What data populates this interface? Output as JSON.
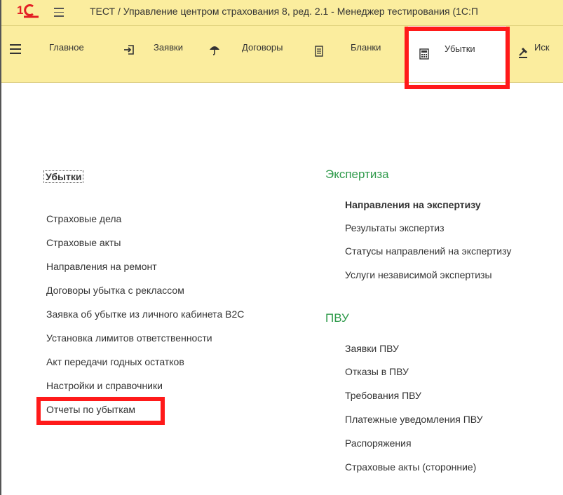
{
  "titlebar": {
    "title": "ТЕСТ / Управление центром страхования 8, ред. 2.1  - Менеджер тестирования (1С:П"
  },
  "sections": {
    "main": "Главное",
    "requests": "Заявки",
    "contracts": "Договоры",
    "forms": "Бланки",
    "losses": "Убытки",
    "more": "Иск"
  },
  "content": {
    "losses_heading": "Убытки",
    "losses_links": [
      "Страховые дела",
      "Страховые акты",
      "Направления на ремонт",
      "Договоры убытка с реклассом",
      "Заявка об убытке из личного кабинета B2C",
      "Установка лимитов ответственности",
      "Акт передачи годных остатков",
      "Настройки и справочники",
      "Отчеты по убыткам"
    ],
    "expertise_heading": "Экспертиза",
    "expertise_links": [
      "Направления на экспертизу",
      "Результаты экспертиз",
      "Статусы направлений на экспертизу",
      "Услуги независимой экспертизы"
    ],
    "pvu_heading": "ПВУ",
    "pvu_links": [
      "Заявки ПВУ",
      "Отказы в ПВУ",
      "Требования ПВУ",
      "Платежные уведомления ПВУ",
      "Распоряжения",
      "Страховые акты (сторонние)"
    ]
  },
  "colors": {
    "panel_bg": "#fbed9e",
    "group_heading": "#2e9a4a",
    "highlight": "#ff1a1a",
    "logo_red": "#e31e24"
  },
  "icons": {
    "logo": "1c-logo-icon",
    "requests": "login-arrow-icon",
    "contracts": "umbrella-icon",
    "forms": "document-icon",
    "losses": "calculator-icon",
    "more": "gavel-icon"
  }
}
